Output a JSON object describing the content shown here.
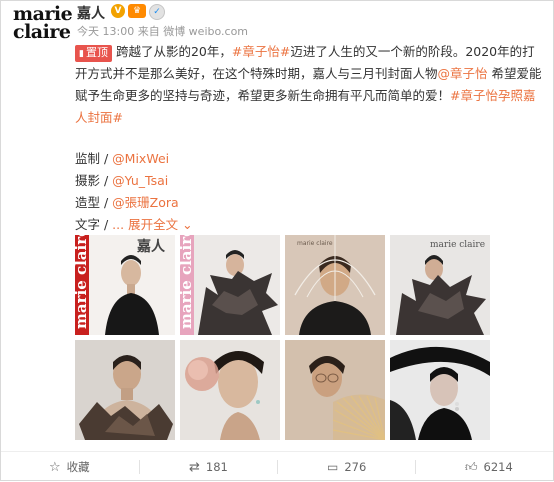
{
  "account": {
    "avatar_logo_line1": "marie",
    "avatar_logo_line2": "claire",
    "name": "嘉人",
    "meta": "今天 13:00 来自 微博 weibo.com"
  },
  "post": {
    "pin_label": "置顶",
    "text_1": "跨越了从影的20年，",
    "tag_1": "#章子怡#",
    "text_2": "迈进了人生的又一个新的阶段。2020年的打开方式并不是那么美好，在这个特殊时期，嘉人与三月刊封面人物",
    "mention_1": "@章子怡",
    "text_3": " 希望爱能赋予生命更多的坚持与奇迹，希望更多新生命拥有平凡而简单的爱！",
    "tag_2": "#章子怡孕照嘉人封面#"
  },
  "credits": [
    {
      "label": "监制 / ",
      "value": "@MixWei"
    },
    {
      "label": "摄影 / ",
      "value": "@Yu_Tsai"
    },
    {
      "label": "造型 / ",
      "value": "@張珊Zora"
    }
  ],
  "credits_more": {
    "label": "文字 / ",
    "expand": "... 展开全文"
  },
  "photos": {
    "cover_brand_1": "marie claire",
    "cover_brand_2": "marie claire",
    "cover_title": "嘉人",
    "cover_brand_3": "marie claire",
    "cover_brand_4": "marie claire"
  },
  "actions": {
    "favorite": "收藏",
    "repost_count": "181",
    "comment_count": "276",
    "like_count": "6214"
  }
}
